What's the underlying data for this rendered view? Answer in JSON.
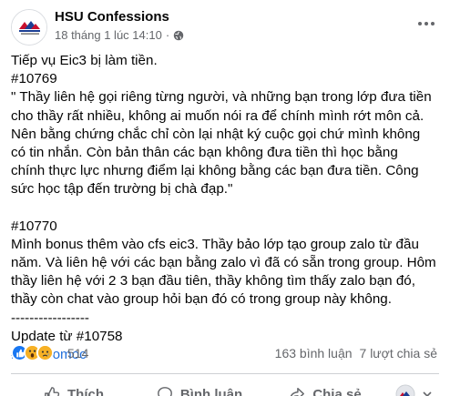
{
  "post": {
    "page_name": "HSU Confessions",
    "timestamp": "18 tháng 1 lúc 14:10",
    "separator": "·",
    "privacy_icon": "globe-icon",
    "lines": [
      "Tiếp vụ Eic3 bị làm tiền.",
      "#10769",
      "\" Thầy liên hệ gọi riêng từng người, và những bạn trong lớp đưa tiền",
      "cho thầy rất nhiều, không ai muốn nói ra để chính mình rớt môn cả.",
      "Nên bằng chứng chắc chỉ còn lại nhật ký cuộc gọi chứ mình không",
      "có tin nhắn. Còn bản thân các bạn không đưa tiền thì học bằng",
      "chính thực lực nhưng điểm lại không bằng các bạn đưa tiền. Công",
      "sức học tập đến trường bị chà đạp.\"",
      "#10770",
      "Mình bonus thêm vào cfs eic3. Thầy bảo lớp tạo group zalo từ đầu",
      "năm. Và liên hệ với các bạn bằng zalo vì đã có sẵn trong group. Hôm",
      "thầy liên hệ với 2 3 bạn đầu tiên, thầy không tìm thấy zalo bạn đó,",
      "thầy còn chat vào group hỏi bạn đó có trong group này không.",
      "-----------------",
      "Update từ #10758"
    ],
    "hashtag": "#chuthomoc"
  },
  "reactions": {
    "types": [
      "like",
      "wow",
      "sad"
    ],
    "count": "514",
    "comments": "163 bình luận",
    "shares": "7 lượt chia sẻ"
  },
  "actions": {
    "like": "Thích",
    "comment": "Bình luận",
    "share": "Chia sẻ"
  },
  "colors": {
    "link": "#216fdb",
    "secondary_text": "#65676b",
    "like_blue": "#1877f2"
  }
}
